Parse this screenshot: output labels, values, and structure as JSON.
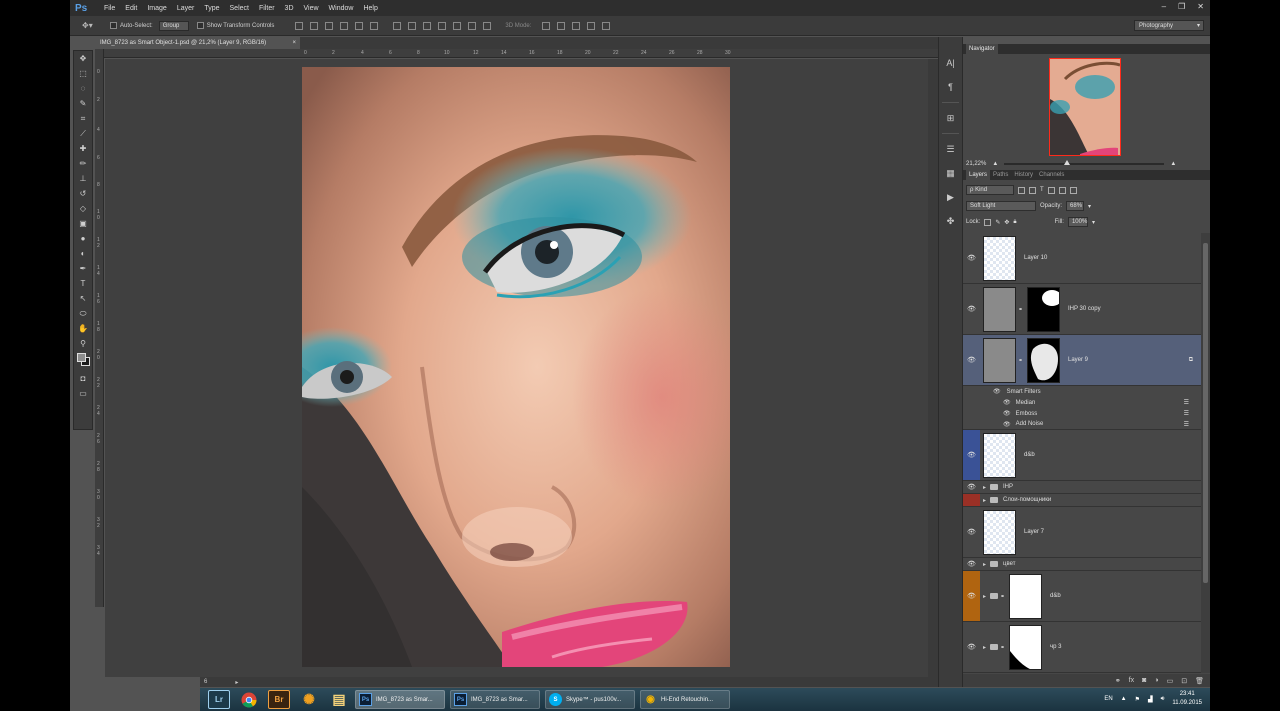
{
  "menubar": {
    "logo": "Ps",
    "items": [
      "File",
      "Edit",
      "Image",
      "Layer",
      "Type",
      "Select",
      "Filter",
      "3D",
      "View",
      "Window",
      "Help"
    ],
    "window_controls": [
      "–",
      "❐",
      "✕"
    ]
  },
  "options_bar": {
    "auto_select_label": "Auto-Select:",
    "auto_select_value": "Group",
    "show_transform_label": "Show Transform Controls",
    "mode_3d_label": "3D Mode:",
    "workspace": "Photography"
  },
  "document": {
    "tab_title": "IMG_8723 as Smart Object-1.psd @ 21,2% (Layer 9, RGB/16)",
    "tab_close": "×",
    "status_zoom": "6",
    "ruler_top_labels": [
      "0",
      "2",
      "4",
      "6",
      "8",
      "10",
      "12",
      "14",
      "16",
      "18",
      "20",
      "22",
      "24",
      "26",
      "28",
      "30"
    ],
    "ruler_left_labels": [
      "0",
      "2",
      "4",
      "6",
      "8",
      "1\n0",
      "1\n2",
      "1\n4",
      "1\n6",
      "1\n8",
      "2\n0",
      "2\n2",
      "2\n4",
      "2\n6",
      "2\n8",
      "3\n0",
      "3\n2",
      "3\n4"
    ]
  },
  "tools": [
    "move-icon",
    "marquee-icon",
    "lasso-icon",
    "quick-select-icon",
    "crop-icon",
    "eyedropper-icon",
    "healing-icon",
    "brush-icon",
    "stamp-icon",
    "history-brush-icon",
    "eraser-icon",
    "gradient-icon",
    "blur-icon",
    "dodge-icon",
    "pen-icon",
    "type-icon",
    "path-select-icon",
    "shape-icon",
    "hand-icon",
    "zoom-icon"
  ],
  "tool_glyphs": [
    "✥",
    "⬚",
    "◌",
    "✎",
    "⌗",
    "⟋",
    "✚",
    "✏",
    "⊥",
    "↺",
    "◇",
    "▣",
    "●",
    "◐",
    "✒",
    "T",
    "↖",
    "⬭",
    "✋",
    "⚲"
  ],
  "navigator": {
    "title": "Navigator",
    "zoom": "21,22%"
  },
  "layers_panel": {
    "tabs": [
      "Layers",
      "Paths",
      "History",
      "Channels"
    ],
    "kind_label": "ρ Kind",
    "blend_mode": "Soft Light",
    "opacity_label": "Opacity:",
    "opacity_value": "68%",
    "lock_label": "Lock:",
    "fill_label": "Fill:",
    "fill_value": "100%",
    "layers": {
      "layer10": "Layer 10",
      "ihp30copy": "IHP 30 copy",
      "layer9": "Layer 9",
      "smart_filters": "Smart Filters",
      "filter_median": "Median",
      "filter_emboss": "Emboss",
      "filter_add_noise": "Add Noise",
      "dbb1": "d&b",
      "group_ihp": "IHP",
      "group_helper": "Слои-помощники",
      "layer7": "Layer 7",
      "group_color": "цвет",
      "group_dbb": "d&b",
      "group_cp3": "чр 3"
    },
    "footer_icons": [
      "link-icon",
      "fx-icon",
      "mask-icon",
      "adjustment-icon",
      "group-icon",
      "new-layer-icon",
      "trash-icon"
    ]
  },
  "taskbar": {
    "pinned": [
      {
        "name": "lightroom",
        "label": "Lr",
        "color": "#1c3a4a",
        "fg": "#9fd0ee"
      },
      {
        "name": "chrome",
        "label": "",
        "color": "transparent",
        "fg": "#fff"
      },
      {
        "name": "bridge",
        "label": "Br",
        "color": "#3a2410",
        "fg": "#f0a040"
      },
      {
        "name": "sunflower",
        "label": "✺",
        "color": "transparent",
        "fg": "#f0a020"
      },
      {
        "name": "explorer",
        "label": "▤",
        "color": "transparent",
        "fg": "#f4d27a"
      }
    ],
    "tasks": [
      {
        "label": "IMG_8723 as Smar...",
        "badge": "Ps"
      },
      {
        "label": "IMG_8723 as Smar...",
        "badge": "Ps"
      },
      {
        "label": "Skype™ - pus100v...",
        "badge": "S"
      },
      {
        "label": "Hi-End Retouchin...",
        "badge": "◉"
      }
    ],
    "lang": "EN",
    "time": "23:41",
    "date": "11.09.2015"
  }
}
